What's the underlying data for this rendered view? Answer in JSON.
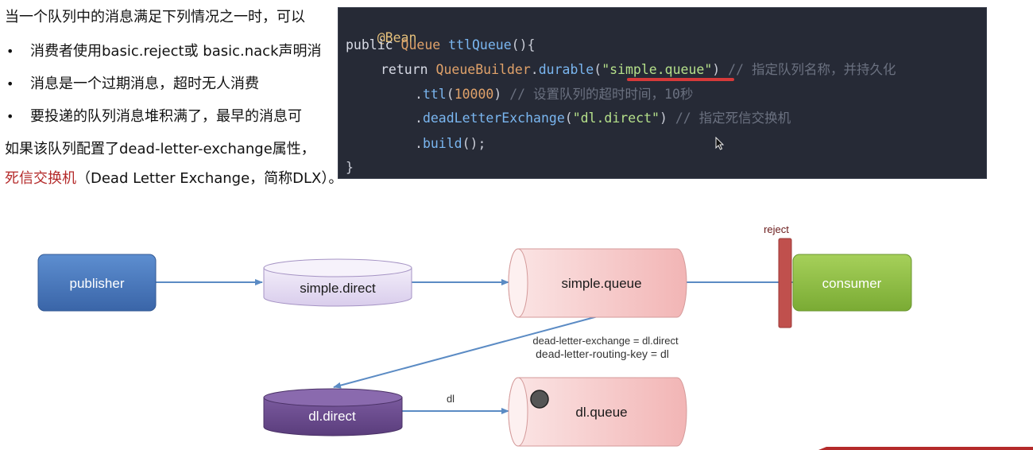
{
  "slide": {
    "line1": "当一个队列中的消息满足下列情况之一时，可以",
    "bullets": [
      "消费者使用basic.reject或 basic.nack声明消",
      "消息是一个过期消息，超时无人消费",
      "要投递的队列消息堆积满了，最早的消息可"
    ],
    "line5": "如果该队列配置了dead-letter-exchange属性，",
    "line6_red": "死信交换机",
    "line6_rest": "（Dead Letter Exchange，简称DLX）。"
  },
  "code": {
    "annotation": "@Bean",
    "l2_public": "public ",
    "l2_type": "Queue ",
    "l2_method": "ttlQueue",
    "l2_rest": "(){",
    "l3_return": "return ",
    "l3_builder": "QueueBuilder",
    "l3_dot": ".",
    "l3_durable": "durable",
    "l3_open": "(",
    "l3_str": "\"simple.queue\"",
    "l3_close": ") ",
    "l3_cmt": "// 指定队列名称，并持久化",
    "l4_dot": ".",
    "l4_ttl": "ttl",
    "l4_open": "(",
    "l4_num": "10000",
    "l4_close": ") ",
    "l4_cmt": "// 设置队列的超时时间，10秒",
    "l5_dot": ".",
    "l5_dle": "deadLetterExchange",
    "l5_open": "(",
    "l5_str": "\"dl.direct\"",
    "l5_close": ") ",
    "l5_cmt": "// 指定死信交换机",
    "l6_dot": ".",
    "l6_build": "build",
    "l6_rest": "();",
    "l7": "}"
  },
  "diagram": {
    "publisher": "publisher",
    "simple_direct": "simple.direct",
    "simple_queue": "simple.queue",
    "consumer": "consumer",
    "reject": "reject",
    "dle_line1": "dead-letter-exchange = dl.direct",
    "dle_line2": "dead-letter-routing-key = dl",
    "dl_direct": "dl.direct",
    "dl_key": "dl",
    "dl_queue": "dl.queue"
  },
  "colors": {
    "publisher": "#4a78c0",
    "consumer": "#8fbf3f",
    "reject_bar": "#c0504d",
    "dl_direct": "#6b4d8c",
    "simple_direct": "#e4dbf2",
    "queue_fill": "#f5c9c9",
    "arrow": "#5b8bc4",
    "code_bg": "#262a36"
  }
}
